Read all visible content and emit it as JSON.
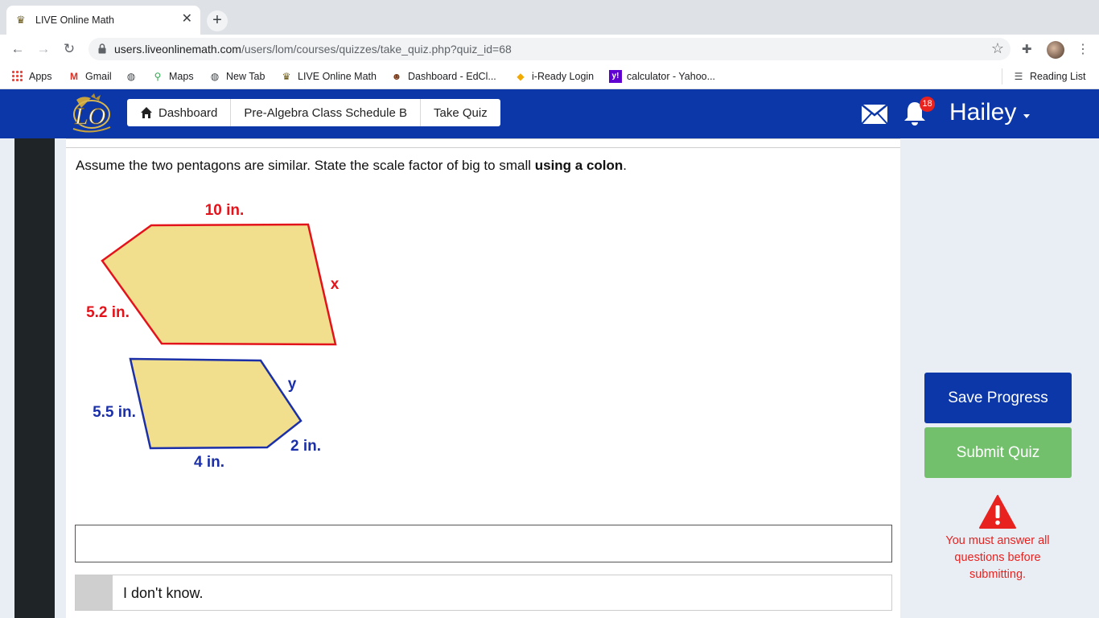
{
  "browser": {
    "tab_title": "LIVE Online Math",
    "url_host": "users.liveonlinemath.com",
    "url_path": "/users/lom/courses/quizzes/take_quiz.php?quiz_id=68",
    "bookmarks": [
      "Apps",
      "Gmail",
      "Maps",
      "New Tab",
      "LIVE Online Math",
      "Dashboard - EdCl...",
      "i-Ready Login",
      "calculator - Yahoo..."
    ],
    "reading_list": "Reading List"
  },
  "header": {
    "breadcrumbs": [
      "Dashboard",
      "Pre-Algebra Class Schedule B",
      "Take Quiz"
    ],
    "notification_count": "18",
    "user_name": "Hailey"
  },
  "question": {
    "text_plain": "Assume the two pentagons are similar. State the scale factor of big to small ",
    "text_bold": "using a colon",
    "text_end": "."
  },
  "figure": {
    "big": {
      "top": "10 in.",
      "left": "5.2 in.",
      "right": "x",
      "color": "#e3131b"
    },
    "small": {
      "left": "5.5 in.",
      "upper_right": "y",
      "lower_right": "2 in.",
      "bottom": "4 in.",
      "color": "#1a2fa8"
    },
    "fill": "#f2df8e"
  },
  "answer": {
    "value": "",
    "idk_label": "I don't know."
  },
  "sidebar": {
    "save_label": "Save Progress",
    "submit_label": "Submit Quiz",
    "warning": "You must answer all questions before submitting."
  },
  "colors": {
    "brand_blue": "#0b37a8",
    "submit_green": "#72c06c",
    "warning_red": "#e8221f"
  }
}
